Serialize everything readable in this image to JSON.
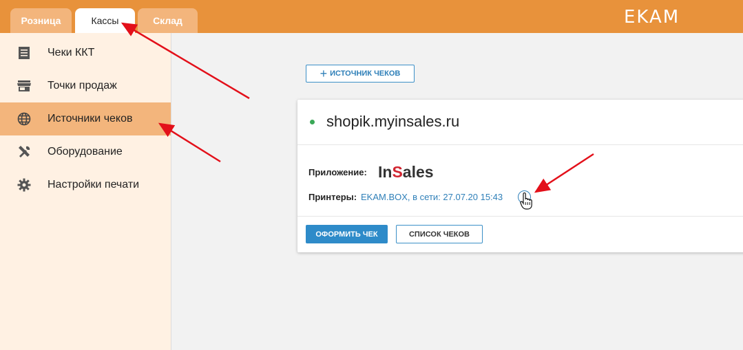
{
  "header": {
    "tabs": [
      {
        "label": "Розница",
        "active": false
      },
      {
        "label": "Кассы",
        "active": true
      },
      {
        "label": "Склад",
        "active": false
      }
    ],
    "logo": "EKAM"
  },
  "sidebar": {
    "items": [
      {
        "label": "Чеки ККТ",
        "icon": "receipt-icon",
        "active": false
      },
      {
        "label": "Точки продаж",
        "icon": "store-icon",
        "active": false
      },
      {
        "label": "Источники чеков",
        "icon": "globe-icon",
        "active": true
      },
      {
        "label": "Оборудование",
        "icon": "tools-icon",
        "active": false
      },
      {
        "label": "Настройки печати",
        "icon": "gear-icon",
        "active": false
      }
    ]
  },
  "main": {
    "add_source_label": "ИСТОЧНИК ЧЕКОВ",
    "card": {
      "domain": "shopik.myinsales.ru",
      "status_color": "#3aa857",
      "app_label": "Приложение:",
      "app_brand_prefix": "In",
      "app_brand_s": "S",
      "app_brand_suffix": "ales",
      "printers_label": "Принтеры:",
      "printers_value": "EKAM.BOX, в сети: 27.07.20 15:43",
      "issue_receipt_label": "ОФОРМИТЬ ЧЕК",
      "receipt_list_label": "СПИСОК ЧЕКОВ"
    }
  },
  "colors": {
    "header": "#e8923b",
    "tab_inactive": "#f3b57c",
    "sidebar_bg": "#fff1e3",
    "accent_blue": "#2e8bc9",
    "annotation_arrow": "#e3101a"
  }
}
